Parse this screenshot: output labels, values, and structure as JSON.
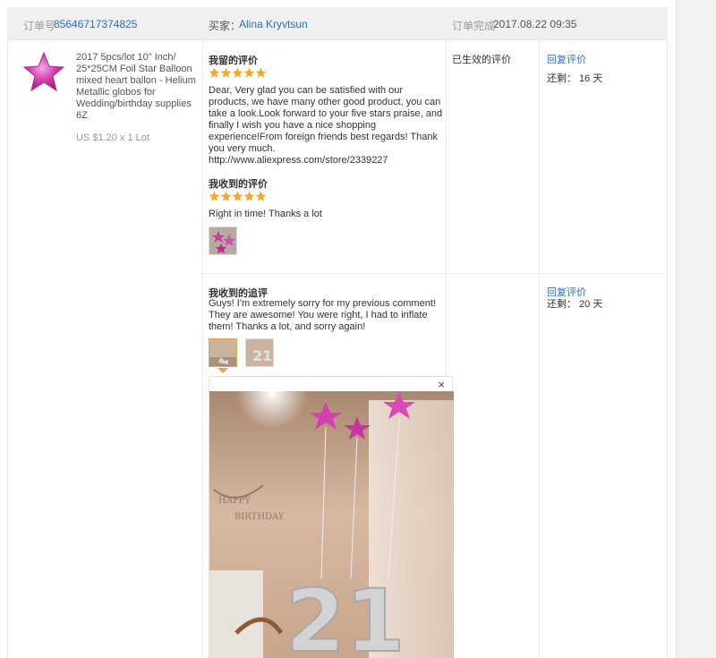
{
  "order": {
    "number_label": "订单号",
    "number": "85646717374825",
    "buyer_label": "买家：",
    "buyer_name": "Alina Kryvtsun",
    "completed_label": "订单完成",
    "completed_time": "2017.08.22 09:35"
  },
  "product": {
    "title": "2017 5pcs/lot 10\" Inch/ 25*25CM Foil Star Balloon mixed heart ballon - Helium Metallic globos for Wedding/birthday supplies 6Z",
    "price": "US $1.20 x 1 Lot",
    "thumb_icon": "pink-star-balloon-icon"
  },
  "my_review": {
    "title": "我留的评价",
    "stars": 5,
    "text": "Dear, Very glad you can be satisfied with our products, we have many other good product, you can take a look.Look forward to your five stars praise, and finally I wish you have a nice shopping experience!From foreign friends best regards! Thank you very much. http://www.aliexpress.com/store/2339227"
  },
  "received_review": {
    "title": "我收到的评价",
    "stars": 5,
    "text": "Right in time! Thanks a lot",
    "status": "已生效的评价",
    "reply_label": "回复评价",
    "remain_text": "还剩： 16 天"
  },
  "followup_review": {
    "title": "我收到的追评",
    "text": "Guys! I'm extremely sorry for my previous comment! They are awesome! You were right, I had to inflate them! Thanks a lot, and sorry again!",
    "reply_label": "回复评价",
    "remain_text": "还剩： 20 天",
    "close_symbol": "×"
  },
  "colors": {
    "link": "#2f6fbd",
    "star": "#f5a623",
    "accent_border": "#e8a24c",
    "balloon_pink": "#d63fb0"
  }
}
